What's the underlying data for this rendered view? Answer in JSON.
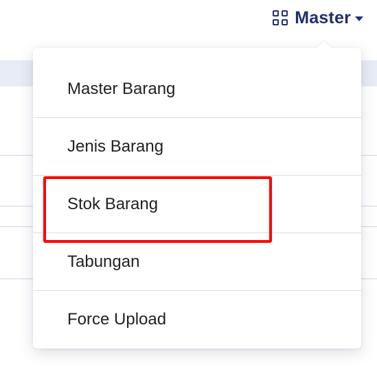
{
  "nav": {
    "label": "Master",
    "icon": "grid-icon",
    "caret_icon": "caret-down-icon",
    "accent_color": "#1f2f72"
  },
  "dropdown": {
    "items": [
      {
        "label": "Master Barang"
      },
      {
        "label": "Jenis Barang"
      },
      {
        "label": "Stok Barang"
      },
      {
        "label": "Tabungan"
      },
      {
        "label": "Force Upload"
      }
    ],
    "highlighted_item": "Stok Barang",
    "highlight_color": "#ff0000"
  }
}
